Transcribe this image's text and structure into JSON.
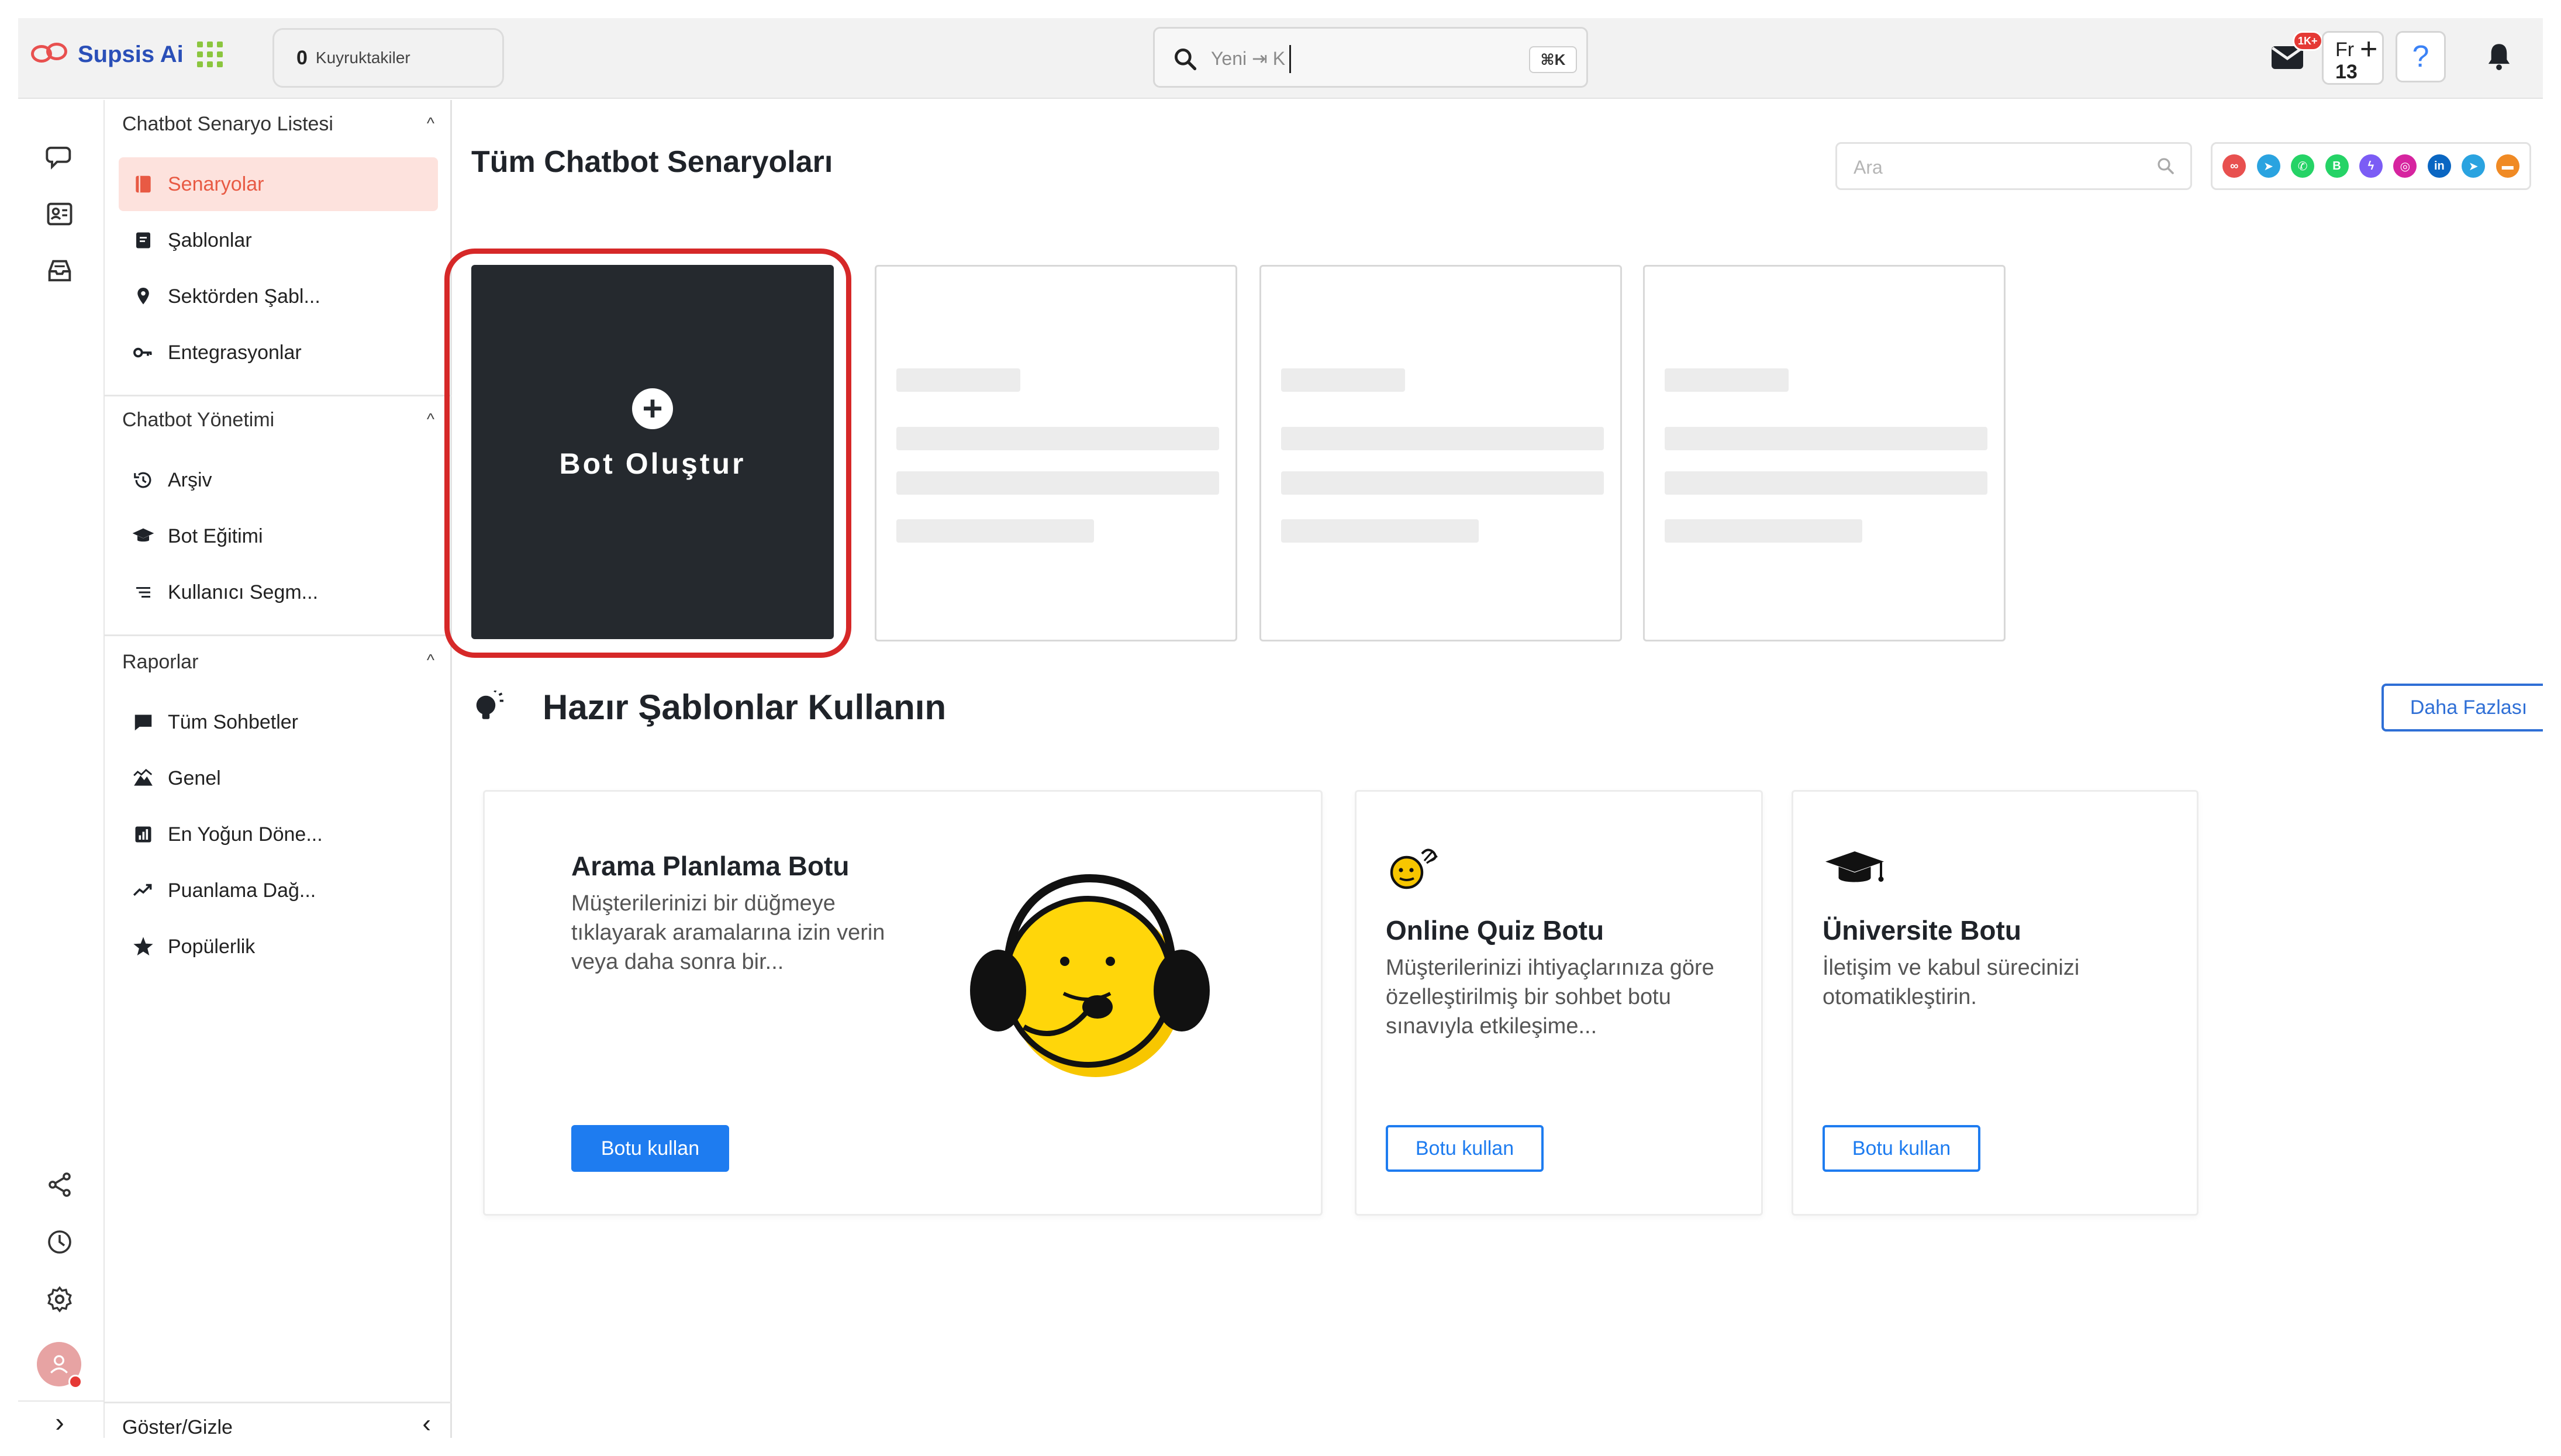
{
  "brand": {
    "name": "Supsis Ai",
    "accent": "#e8504f",
    "primary": "#1e7cf0"
  },
  "topbar": {
    "queue_count": "0",
    "queue_label": "Kuyruktakiler",
    "search_placeholder": "Yeni ⇥ K",
    "search_shortcut": "⌘K",
    "mail_badge": "1K+",
    "lang_code": "Fr",
    "lang_day": "13",
    "lang_plus": "+",
    "help_label": "?"
  },
  "rail": {
    "icons": [
      "chat-bubble-icon",
      "contact-card-icon",
      "inbox-icon",
      "share-icon",
      "clock-icon",
      "settings-icon",
      "avatar"
    ],
    "expand": "›"
  },
  "menu": {
    "sections": [
      {
        "title": "Chatbot Senaryo Listesi",
        "items": [
          {
            "label": "Senaryolar",
            "icon": "book-icon",
            "active": true
          },
          {
            "label": "Şablonlar",
            "icon": "template-icon"
          },
          {
            "label": "Sektörden Şabl...",
            "icon": "pin-icon"
          },
          {
            "label": "Entegrasyonlar",
            "icon": "key-icon"
          }
        ]
      },
      {
        "title": "Chatbot Yönetimi",
        "items": [
          {
            "label": "Arşiv",
            "icon": "history-icon"
          },
          {
            "label": "Bot Eğitimi",
            "icon": "graduation-cap-icon"
          },
          {
            "label": "Kullanıcı Segm...",
            "icon": "list-icon"
          }
        ]
      },
      {
        "title": "Raporlar",
        "items": [
          {
            "label": "Tüm Sohbetler",
            "icon": "message-icon"
          },
          {
            "label": "Genel",
            "icon": "mountain-icon"
          },
          {
            "label": "En Yoğun Döne...",
            "icon": "bar-chart-icon"
          },
          {
            "label": "Puanlama Dağ...",
            "icon": "trend-icon"
          },
          {
            "label": "Popülerlik",
            "icon": "star-icon"
          }
        ]
      }
    ],
    "chevron": "^",
    "footer_label": "Göster/Gizle",
    "footer_chevron": "‹"
  },
  "main": {
    "title": "Tüm Chatbot Senaryoları",
    "search_placeholder": "Ara",
    "channels": [
      {
        "name": "supsis",
        "color": "#e8504f",
        "glyph": "∞"
      },
      {
        "name": "telegram",
        "color": "#2aa3e0",
        "glyph": "➤"
      },
      {
        "name": "whatsapp",
        "color": "#25d366",
        "glyph": "✆"
      },
      {
        "name": "whatsapp-business",
        "color": "#25d366",
        "glyph": "B"
      },
      {
        "name": "messenger",
        "color": "#7b5cf5",
        "glyph": "ϟ"
      },
      {
        "name": "instagram",
        "color": "#d6249f",
        "glyph": "◎"
      },
      {
        "name": "linkedin",
        "color": "#0a66c2",
        "glyph": "in"
      },
      {
        "name": "telegram-2",
        "color": "#2aa3e0",
        "glyph": "➤"
      },
      {
        "name": "email",
        "color": "#f08a24",
        "glyph": "▬"
      }
    ],
    "create_plus": "+",
    "create_label": "Bot Oluştur",
    "templates_title": "Hazır Şablonlar Kullanın",
    "more_label": "Daha Fazlası",
    "templates": [
      {
        "title": "Arama Planlama Botu",
        "description": "Müşterilerinizi bir düğmeye tıklayarak aramalarına izin verin veya daha sonra bir...",
        "button": "Botu kullan"
      },
      {
        "title": "Online Quiz Botu",
        "description": "Müşterilerinizi ihtiyaçlarınıza göre özelleştirilmiş bir sohbet botu sınavıyla etkileşime...",
        "button": "Botu kullan"
      },
      {
        "title": "Üniversite Botu",
        "description": "İletişim ve kabul sürecinizi otomatikleştirin.",
        "button": "Botu kullan"
      }
    ]
  }
}
